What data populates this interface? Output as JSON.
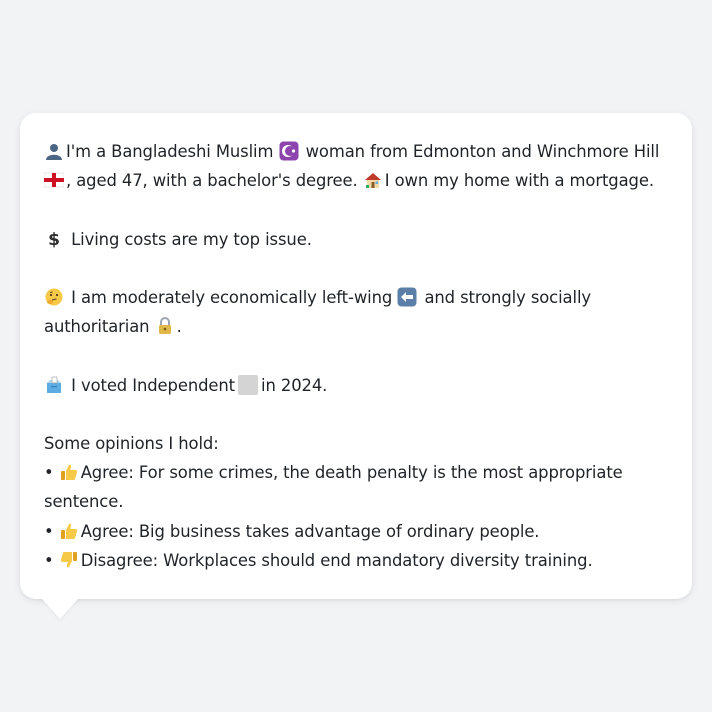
{
  "message": {
    "intro_1": "I'm a Bangladeshi Muslim",
    "intro_2": "woman from Edmonton and Winchmore Hill",
    "intro_3": ", aged 47, with a bachelor's degree.",
    "intro_4": "I own my home with a mortgage.",
    "issue": "Living costs are my top issue.",
    "politics_1": "I am moderately economically left-wing",
    "politics_2": "and strongly socially authoritarian",
    "politics_3": ".",
    "vote_1": "I voted Independent",
    "vote_2": "in 2024.",
    "opinions_heading": "Some opinions I hold:",
    "opinions": [
      {
        "stance": "Agree",
        "text": "For some crimes, the death penalty is the most appropriate sentence."
      },
      {
        "stance": "Agree",
        "text": "Big business takes advantage of ordinary people."
      },
      {
        "stance": "Disagree",
        "text": "Workplaces should end mandatory diversity training."
      }
    ]
  },
  "icons": [
    "person-icon",
    "star-crescent-icon",
    "england-flag-icon",
    "house-icon",
    "dollar-icon",
    "thinking-face-icon",
    "left-arrow-icon",
    "lock-icon",
    "ballot-box-icon",
    "grey-square-icon",
    "thumbs-up-icon",
    "thumbs-down-icon"
  ],
  "colors": {
    "background": "#f2f3f5",
    "bubble": "#ffffff",
    "text": "#1f2328"
  }
}
